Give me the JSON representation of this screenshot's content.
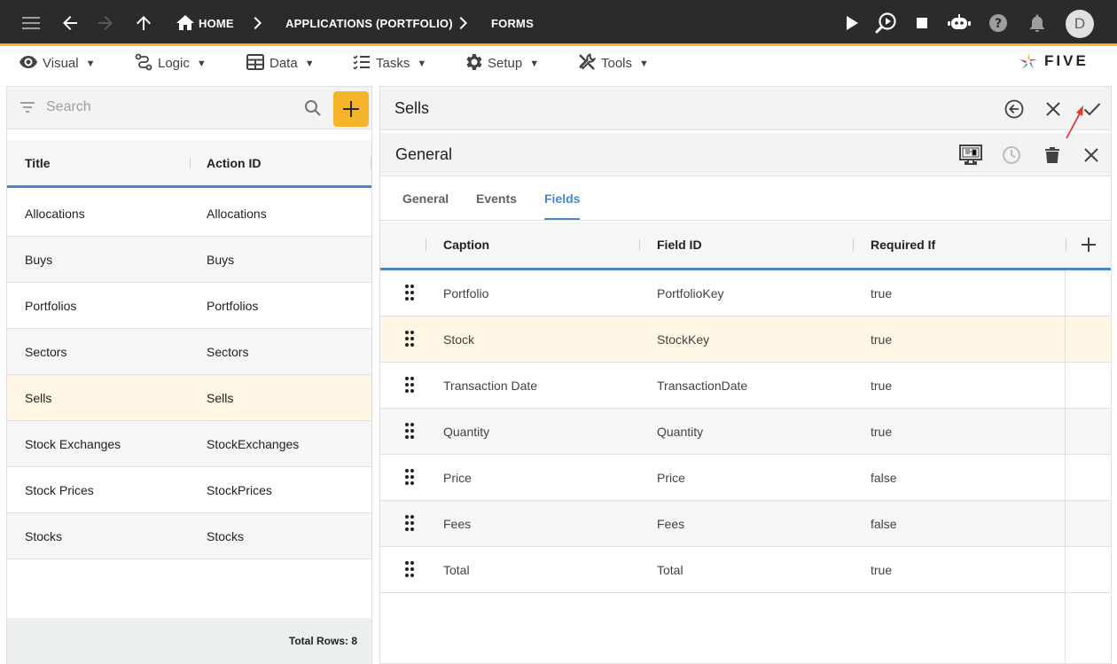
{
  "topbar": {
    "crumbs": [
      "HOME",
      "APPLICATIONS (PORTFOLIO)",
      "FORMS"
    ],
    "avatar_letter": "D",
    "icons": [
      "menu-icon",
      "back-arrow-icon",
      "forward-arrow-icon",
      "up-arrow-icon",
      "home-icon",
      "play-icon",
      "debug-search-icon",
      "stop-icon",
      "chat-bot-icon",
      "help-icon",
      "bell-icon"
    ]
  },
  "menubar": {
    "items": [
      {
        "label": "Visual",
        "icon": "eye-icon"
      },
      {
        "label": "Logic",
        "icon": "logic-icon"
      },
      {
        "label": "Data",
        "icon": "table-icon"
      },
      {
        "label": "Tasks",
        "icon": "tasks-icon"
      },
      {
        "label": "Setup",
        "icon": "gear-icon"
      },
      {
        "label": "Tools",
        "icon": "tools-icon"
      }
    ],
    "logo_text": "FIVE"
  },
  "left": {
    "search_placeholder": "Search",
    "columns": [
      "Title",
      "Action ID"
    ],
    "rows": [
      {
        "title": "Allocations",
        "action_id": "Allocations"
      },
      {
        "title": "Buys",
        "action_id": "Buys"
      },
      {
        "title": "Portfolios",
        "action_id": "Portfolios"
      },
      {
        "title": "Sectors",
        "action_id": "Sectors"
      },
      {
        "title": "Sells",
        "action_id": "Sells"
      },
      {
        "title": "Stock Exchanges",
        "action_id": "StockExchanges"
      },
      {
        "title": "Stock Prices",
        "action_id": "StockPrices"
      },
      {
        "title": "Stocks",
        "action_id": "Stocks"
      }
    ],
    "selected_index": 4,
    "footer": "Total Rows: 8"
  },
  "right": {
    "title": "Sells",
    "section_title": "General",
    "tabs": [
      {
        "label": "General",
        "active": false
      },
      {
        "label": "Events",
        "active": false
      },
      {
        "label": "Fields",
        "active": true
      }
    ],
    "columns": [
      "Caption",
      "Field ID",
      "Required If"
    ],
    "rows": [
      {
        "caption": "Portfolio",
        "field_id": "PortfolioKey",
        "required_if": "true"
      },
      {
        "caption": "Stock",
        "field_id": "StockKey",
        "required_if": "true"
      },
      {
        "caption": "Transaction Date",
        "field_id": "TransactionDate",
        "required_if": "true"
      },
      {
        "caption": "Quantity",
        "field_id": "Quantity",
        "required_if": "true"
      },
      {
        "caption": "Price",
        "field_id": "Price",
        "required_if": "false"
      },
      {
        "caption": "Fees",
        "field_id": "Fees",
        "required_if": "false"
      },
      {
        "caption": "Total",
        "field_id": "Total",
        "required_if": "true"
      }
    ],
    "highlighted_index": 1
  },
  "colors": {
    "accent": "#f6b42a",
    "primary_blue": "#4a86c8",
    "topbar": "#2b2b2b",
    "selected_row": "#fff6e6",
    "annotation_arrow": "#e53935"
  }
}
